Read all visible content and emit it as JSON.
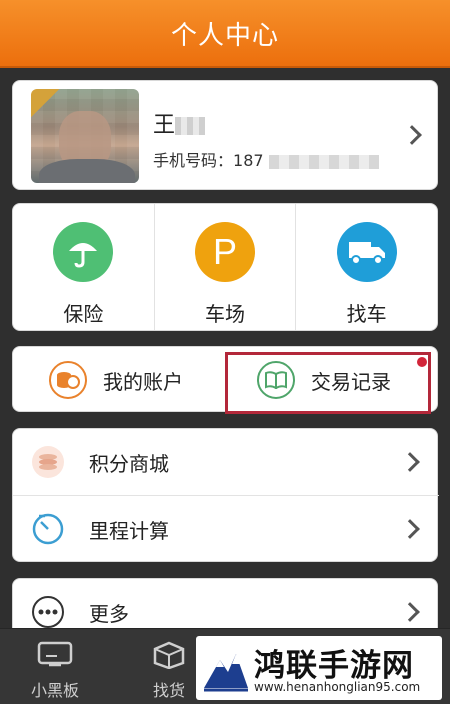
{
  "header": {
    "title": "个人中心"
  },
  "profile": {
    "name": "王",
    "phone_label": "手机号码：",
    "phone_visible": "187"
  },
  "services": [
    {
      "label": "保险",
      "icon": "umbrella-icon",
      "color": "#4fbf74"
    },
    {
      "label": "车场",
      "icon": "parking-icon",
      "color": "#efa20e"
    },
    {
      "label": "找车",
      "icon": "truck-icon",
      "color": "#1f9ed8"
    }
  ],
  "account": [
    {
      "label": "我的账户",
      "icon": "coins-icon",
      "color": "#e9822c"
    },
    {
      "label": "交易记录",
      "icon": "book-icon",
      "color": "#4fa56a"
    }
  ],
  "list": [
    {
      "label": "积分商城",
      "icon": "points-icon"
    },
    {
      "label": "里程计算",
      "icon": "mileage-icon"
    }
  ],
  "more": {
    "label": "更多"
  },
  "tabbar": [
    {
      "label": "小黑板"
    },
    {
      "label": "找货"
    }
  ],
  "watermark": {
    "brand": "鸿联手游网",
    "url": "www.henanhonglian95.com"
  }
}
